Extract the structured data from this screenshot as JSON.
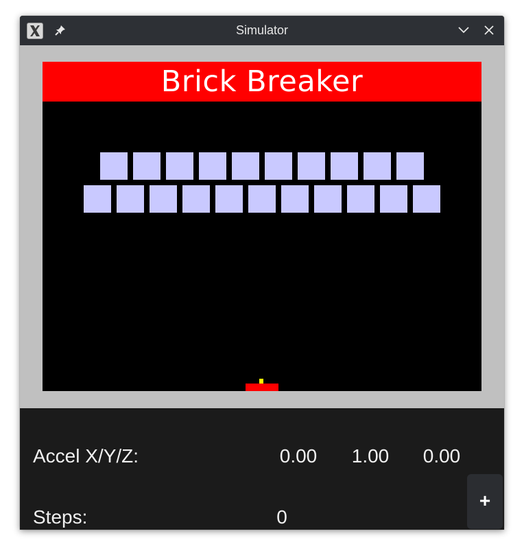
{
  "window": {
    "title": "Simulator"
  },
  "game": {
    "title": "Brick Breaker",
    "colors": {
      "banner": "#ff0000",
      "background": "#000000",
      "brick": "#c9c9ff",
      "paddle": "#ff0000",
      "ball": "#ffff00",
      "frame": "#c0c0c0"
    },
    "brick_rows": [
      {
        "count": 10
      },
      {
        "count": 11
      }
    ]
  },
  "panel": {
    "accel_label": "Accel X/Y/Z:",
    "accel_x": "0.00",
    "accel_y": "1.00",
    "accel_z": "0.00",
    "steps_label": "Steps:",
    "steps_value": "0",
    "add_label": "+"
  }
}
